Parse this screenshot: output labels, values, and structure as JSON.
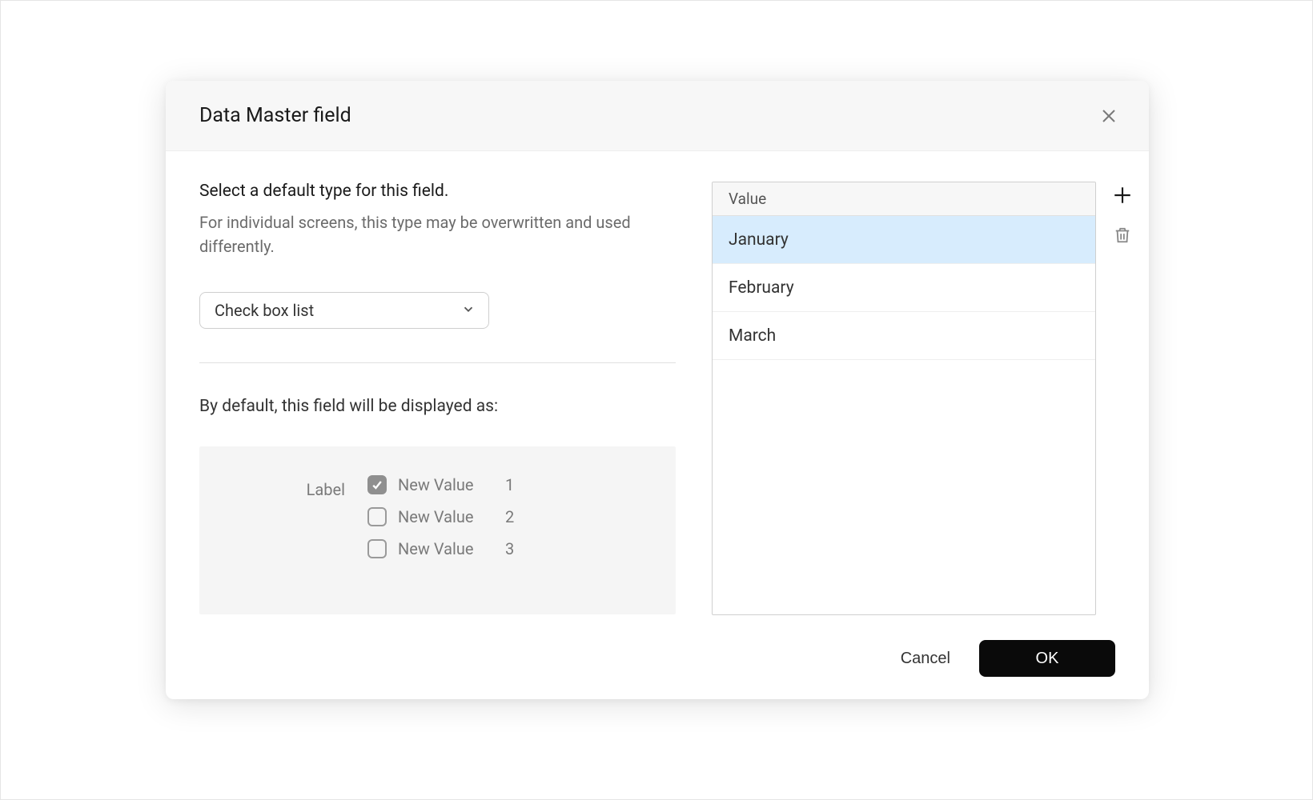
{
  "dialog": {
    "title": "Data Master field",
    "lead": "Select a default type for this field.",
    "sub": "For individual screens, this type may be overwritten and used differently.",
    "type_select": {
      "value": "Check box list"
    },
    "display_as_label": "By default, this field will be displayed as:",
    "preview": {
      "label": "Label",
      "items": [
        {
          "name": "New Value",
          "num": "1",
          "checked": true
        },
        {
          "name": "New Value",
          "num": "2",
          "checked": false
        },
        {
          "name": "New Value",
          "num": "3",
          "checked": false
        }
      ]
    },
    "values": {
      "header": "Value",
      "items": [
        {
          "label": "January",
          "selected": true
        },
        {
          "label": "February",
          "selected": false
        },
        {
          "label": "March",
          "selected": false
        }
      ]
    },
    "footer": {
      "cancel": "Cancel",
      "ok": "OK"
    }
  }
}
